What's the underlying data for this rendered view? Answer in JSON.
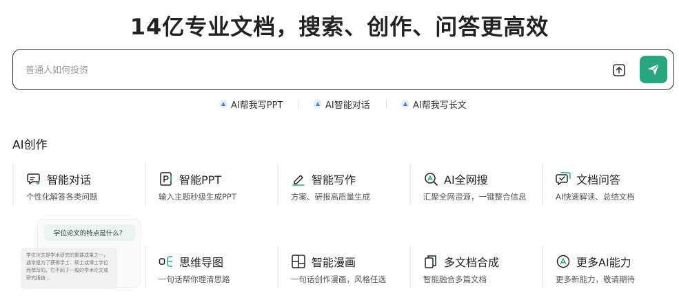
{
  "hero": {
    "title": "14亿专业文档，搜索、创作、问答更高效"
  },
  "search": {
    "placeholder": "普通人如何投资"
  },
  "quick_links": [
    {
      "label": "AI帮我写PPT"
    },
    {
      "label": "AI智能对话"
    },
    {
      "label": "AI帮我写长文"
    }
  ],
  "section": {
    "title": "AI创作"
  },
  "cards": [
    {
      "title": "智能对话",
      "desc": "个性化解答各类问题",
      "icon": "chat-icon"
    },
    {
      "title": "智能PPT",
      "desc": "输入主题秒级生成PPT",
      "icon": "ppt-icon"
    },
    {
      "title": "智能写作",
      "desc": "方案、研报高质量生成",
      "icon": "pen-icon"
    },
    {
      "title": "AI全网搜",
      "desc": "汇聚全网资源，一键整合信息",
      "icon": "search-web-icon"
    },
    {
      "title": "文档问答",
      "desc": "AI快速解读、总结文档",
      "icon": "doc-qa-icon"
    },
    {
      "title": "思维导图",
      "desc": "一句话帮你理清思路",
      "icon": "mindmap-icon"
    },
    {
      "title": "智能漫画",
      "desc": "一句话创作漫画，风格任选",
      "icon": "comic-icon"
    },
    {
      "title": "多文档合成",
      "desc": "智能融合多篇文档",
      "icon": "multi-doc-icon"
    },
    {
      "title": "更多AI能力",
      "desc": "更多新能力，敬请期待",
      "icon": "more-ai-icon"
    }
  ],
  "preview": {
    "question": "学位论文的特点是什么？",
    "answer": "学位论文是学术研究的重要成果之一，通常是为了获得学士、硕士或博士学位而撰写的。它不同于一般的学术论文或研究报告..."
  },
  "colors": {
    "accent": "#2aa77f",
    "text": "#222222",
    "muted": "#555555"
  }
}
